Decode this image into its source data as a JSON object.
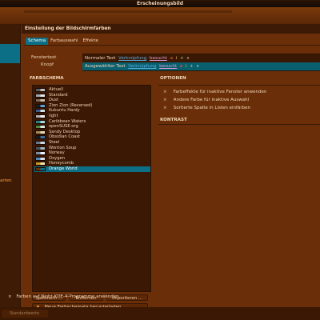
{
  "window": {
    "title": "Erscheinungsbild"
  },
  "sidebar": {
    "partial_label": "arten"
  },
  "panel": {
    "header": "Einstellung der Bildschirmfarben",
    "tabs": [
      {
        "label": "Schema",
        "active": true
      },
      {
        "label": "Farbauswahl",
        "active": false
      },
      {
        "label": "Effekte",
        "active": false
      }
    ]
  },
  "preview": {
    "fenstertext_label": "Fenstertext",
    "knopf_label": "Knopf",
    "normal": {
      "text": "Normaler Text",
      "link": "Verknüpfung",
      "visited": "besucht",
      "neg": "a",
      "neu": "i",
      "pos": "+",
      "act": "»"
    },
    "selected": {
      "text": "Ausgewählter Text",
      "link": "Verknüpfung",
      "visited": "besucht",
      "neg": "a",
      "neu": "i",
      "pos": "+",
      "act": "»"
    }
  },
  "schemes": {
    "label": "FARBSCHEMA",
    "items": [
      {
        "name": "Aktuell",
        "colors": [
          "#5a5a5a",
          "#c0c0c0"
        ]
      },
      {
        "name": "Standard",
        "colors": [
          "#9fa7b0",
          "#e6e6e6"
        ]
      },
      {
        "name": "Dust",
        "colors": [
          "#7f6a55",
          "#cfc0a8"
        ]
      },
      {
        "name": "Zion Zion (Reversed)",
        "colors": [
          "#1e1e1e",
          "#5ea0d0"
        ]
      },
      {
        "name": "Kubuntu Hardy",
        "colors": [
          "#3a5f8f",
          "#dcdcdc"
        ]
      },
      {
        "name": "light",
        "colors": [
          "#b0b0b0",
          "#f4f4f4"
        ]
      },
      {
        "name": "Caribbean Waters",
        "colors": [
          "#2a7f88",
          "#a9d6d6"
        ]
      },
      {
        "name": "openSUSE.org",
        "colors": [
          "#4c8a3c",
          "#e4e4e4"
        ]
      },
      {
        "name": "Sandy Desktop",
        "colors": [
          "#a68b55",
          "#eadcb8"
        ]
      },
      {
        "name": "Obsidian Coast",
        "colors": [
          "#1a1a1a",
          "#3d6a9a"
        ]
      },
      {
        "name": "Steel",
        "colors": [
          "#6a7a8a",
          "#cfd6dc"
        ]
      },
      {
        "name": "Wonton Soup",
        "colors": [
          "#4a5562",
          "#a7b3be"
        ]
      },
      {
        "name": "Norway",
        "colors": [
          "#7a8ea2",
          "#eef0f3"
        ]
      },
      {
        "name": "Oxygen",
        "colors": [
          "#4d86c0",
          "#e0dfde"
        ]
      },
      {
        "name": "Honeycomb",
        "colors": [
          "#c99a1f",
          "#f1e4b4"
        ]
      },
      {
        "name": "Orange World",
        "colors": [
          "#6a2f08",
          "#0d6f86"
        ],
        "selected": true
      }
    ],
    "buttons": {
      "save": "Speichern ...",
      "remove": "Entfernen",
      "import": "Importieren ...",
      "download": "Neue Farbschemata herunterladen ..."
    }
  },
  "options": {
    "label": "OPTIONEN",
    "items": [
      "Farbeffekte für inaktive Fenster anwenden",
      "Andere Farbe für inaktive Auswahl",
      "Sortierte Spalte in Listen einfärben"
    ]
  },
  "contrast": {
    "label": "KONTRAST"
  },
  "footer": {
    "nonkde_label": "Farben auf Nicht-KDE-4-Programme anwenden",
    "status_button": "Standardwerte"
  }
}
